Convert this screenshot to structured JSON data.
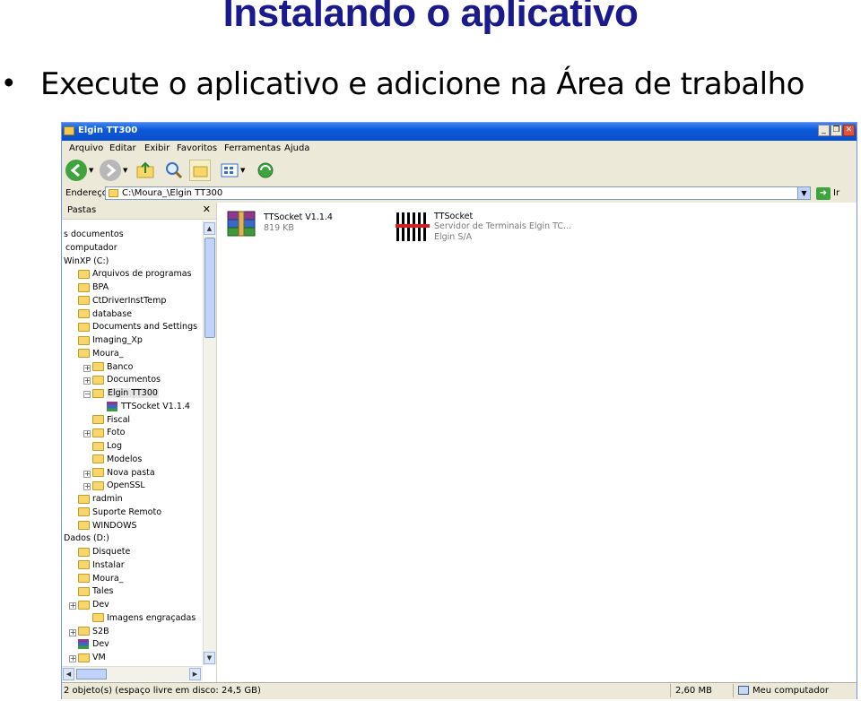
{
  "slide": {
    "title": "Instalando o aplicativo",
    "bullet": "Execute o aplicativo e adicione na Área de trabalho"
  },
  "window": {
    "title": "Elgin TT300",
    "menu": [
      "Arquivo",
      "Editar",
      "Exibir",
      "Favoritos",
      "Ferramentas",
      "Ajuda"
    ],
    "address_label": "Endereço",
    "address_value": "C:\\Moura_\\Elgin TT300",
    "go_label": "Ir",
    "tree_header": "Pastas",
    "tree": [
      {
        "label": "s documentos",
        "icon": "none"
      },
      {
        "label": "computador",
        "icon": "none"
      },
      {
        "label": "WinXP (C:)",
        "icon": "none"
      },
      {
        "label": "Arquivos de programas",
        "icon": "folder"
      },
      {
        "label": "BPA",
        "icon": "folder"
      },
      {
        "label": "CtDriverInstTemp",
        "icon": "folder"
      },
      {
        "label": "database",
        "icon": "folder"
      },
      {
        "label": "Documents and Settings",
        "icon": "folder"
      },
      {
        "label": "Imaging_Xp",
        "icon": "folder"
      },
      {
        "label": "Moura_",
        "icon": "folder"
      },
      {
        "label": "Banco",
        "icon": "folder"
      },
      {
        "label": "Documentos",
        "icon": "folder"
      },
      {
        "label": "Elgin TT300",
        "icon": "folder"
      },
      {
        "label": "TTSocket V1.1.4",
        "icon": "rar"
      },
      {
        "label": "Fiscal",
        "icon": "folder"
      },
      {
        "label": "Foto",
        "icon": "folder"
      },
      {
        "label": "Log",
        "icon": "folder"
      },
      {
        "label": "Modelos",
        "icon": "folder"
      },
      {
        "label": "Nova pasta",
        "icon": "folder"
      },
      {
        "label": "OpenSSL",
        "icon": "folder"
      },
      {
        "label": "radmin",
        "icon": "folder"
      },
      {
        "label": "Suporte Remoto",
        "icon": "folder"
      },
      {
        "label": "WINDOWS",
        "icon": "folder"
      },
      {
        "label": "Dados (D:)",
        "icon": "none"
      },
      {
        "label": "Disquete",
        "icon": "folder"
      },
      {
        "label": "Instalar",
        "icon": "folder"
      },
      {
        "label": "Moura_",
        "icon": "folder"
      },
      {
        "label": "Tales",
        "icon": "folder"
      },
      {
        "label": "Dev",
        "icon": "folder"
      },
      {
        "label": "Imagens engraçadas",
        "icon": "folder"
      },
      {
        "label": "S2B",
        "icon": "folder"
      },
      {
        "label": "Dev",
        "icon": "rar"
      },
      {
        "label": "VM",
        "icon": "folder"
      }
    ],
    "files": [
      {
        "name": "TTSocket V1.1.4",
        "line2": "819 KB",
        "line3": "",
        "icon": "winrar-archive-icon"
      },
      {
        "name": "TTSocket",
        "line2": "Servidor de Terminais Elgin TC...",
        "line3": "Elgin S/A",
        "icon": "ttsocket-app-icon"
      }
    ],
    "status": {
      "left": "2 objeto(s) (espaço livre em disco: 24,5 GB)",
      "size": "2,60 MB",
      "location": "Meu computador"
    }
  }
}
